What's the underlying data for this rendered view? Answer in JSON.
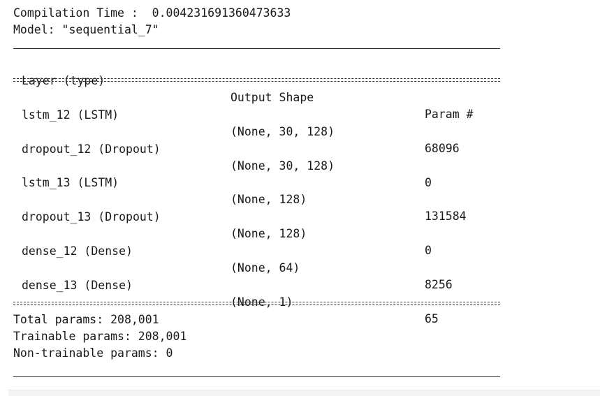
{
  "header": {
    "compilation_line": "Compilation Time :  0.004231691360473633",
    "model_line": "Model: \"sequential_7\""
  },
  "table": {
    "headers": {
      "layer": "Layer (type)",
      "shape": "Output Shape",
      "param": "Param #"
    },
    "rows": [
      {
        "layer": "lstm_12 (LSTM)",
        "shape": "(None, 30, 128)",
        "param": "68096"
      },
      {
        "layer": "dropout_12 (Dropout)",
        "shape": "(None, 30, 128)",
        "param": "0"
      },
      {
        "layer": "lstm_13 (LSTM)",
        "shape": "(None, 128)",
        "param": "131584"
      },
      {
        "layer": "dropout_13 (Dropout)",
        "shape": "(None, 128)",
        "param": "0"
      },
      {
        "layer": "dense_12 (Dense)",
        "shape": "(None, 64)",
        "param": "8256"
      },
      {
        "layer": "dense_13 (Dense)",
        "shape": "(None, 1)",
        "param": "65"
      }
    ]
  },
  "summary": {
    "total": "Total params: 208,001",
    "trainable": "Trainable params: 208,001",
    "non_trainable": "Non-trainable params: 0"
  }
}
